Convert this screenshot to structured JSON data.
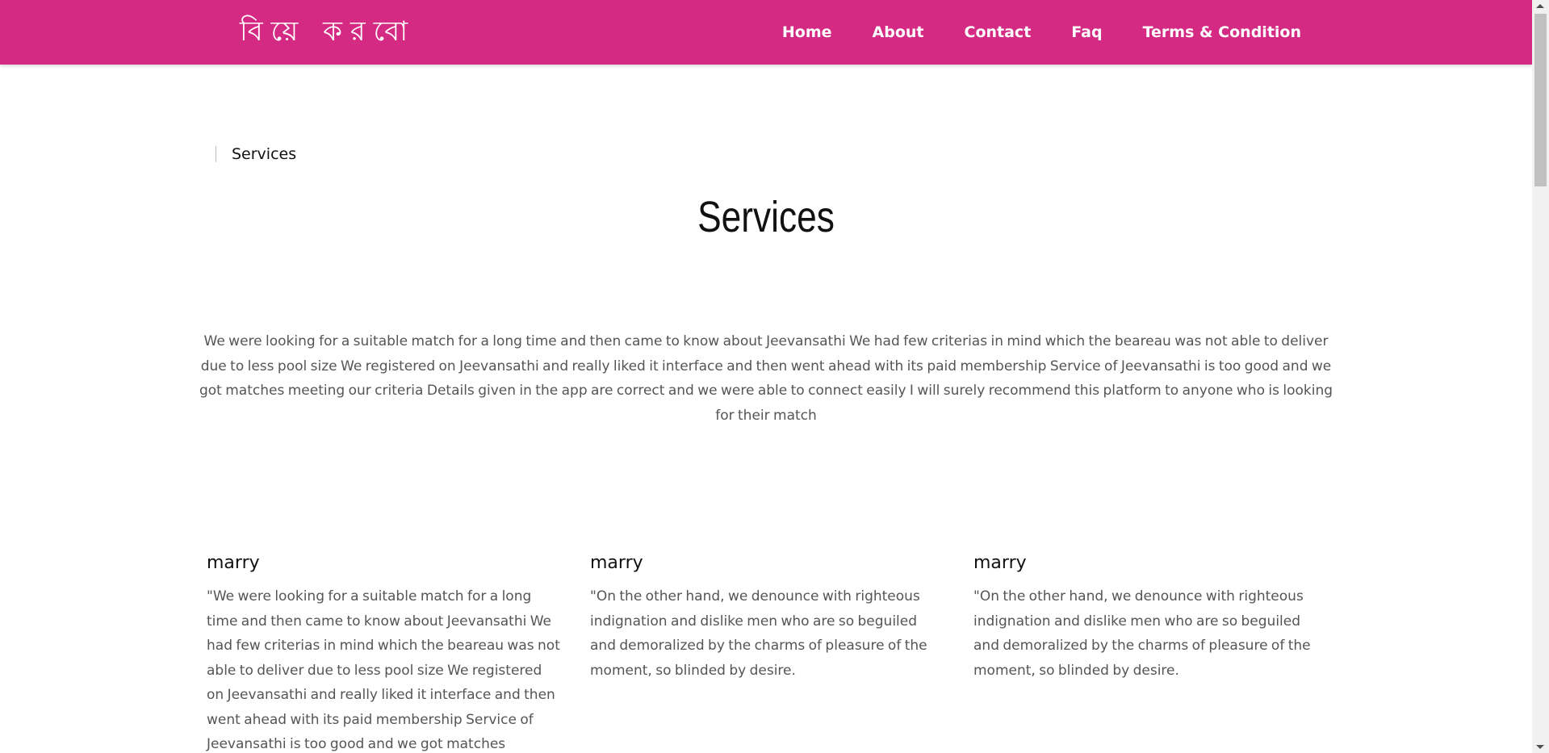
{
  "header": {
    "logo": "বিয়ে করবো",
    "nav": [
      "Home",
      "About",
      "Contact",
      "Faq",
      "Terms & Condition"
    ]
  },
  "colors": {
    "header_bg": "#d42a84",
    "text_body": "#555555",
    "text_heading": "#111111"
  },
  "breadcrumb": {
    "current": "Services"
  },
  "page": {
    "title": "Services",
    "intro": "We were looking for a suitable match for a long time and then came to know about Jeevansathi We had few criterias in mind which the beareau was not able to deliver due to less pool size We registered on Jeevansathi and really liked it interface and then went ahead with its paid membership Service of Jeevansathi is too good and we got matches meeting our criteria Details given in the app are correct and we were able to connect easily I will surely recommend this platform to anyone who is looking for their match"
  },
  "cards": [
    {
      "title": "marry",
      "text": "\"We were looking for a suitable match for a long time and then came to know about Jeevansathi We had few criterias in mind which the beareau was not able to deliver due to less pool size We registered on Jeevansathi and really liked it interface and then went ahead with its paid membership Service of Jeevansathi is too good and we got matches meeting our criteria"
    },
    {
      "title": "marry",
      "text": "\"On the other hand, we denounce with righteous indignation and dislike men who are so beguiled and demoralized by the charms of pleasure of the moment, so blinded by desire."
    },
    {
      "title": "marry",
      "text": "\"On the other hand, we denounce with righteous indignation and dislike men who are so beguiled and demoralized by the charms of pleasure of the moment, so blinded by desire."
    }
  ]
}
